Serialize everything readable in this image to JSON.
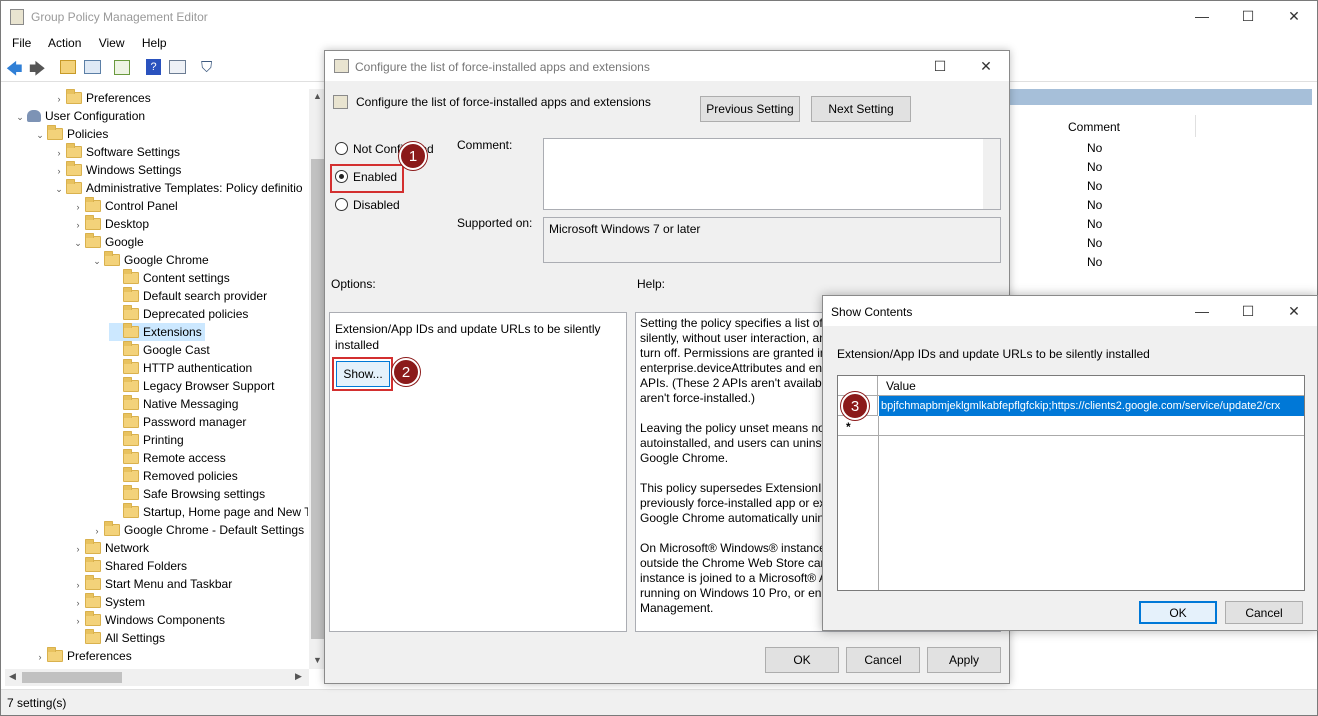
{
  "main_window": {
    "title": "Group Policy Management Editor",
    "menu": [
      "File",
      "Action",
      "View",
      "Help"
    ],
    "status": "7 setting(s)"
  },
  "tree": [
    {
      "label": "Preferences",
      "indent": 2,
      "chev": "›"
    },
    {
      "label": "User Configuration",
      "indent": 0,
      "chev": "⌄",
      "icon": "user"
    },
    {
      "label": "Policies",
      "indent": 1,
      "chev": "⌄"
    },
    {
      "label": "Software Settings",
      "indent": 2,
      "chev": "›"
    },
    {
      "label": "Windows Settings",
      "indent": 2,
      "chev": "›"
    },
    {
      "label": "Administrative Templates: Policy definitio",
      "indent": 2,
      "chev": "⌄"
    },
    {
      "label": "Control Panel",
      "indent": 3,
      "chev": "›"
    },
    {
      "label": "Desktop",
      "indent": 3,
      "chev": "›"
    },
    {
      "label": "Google",
      "indent": 3,
      "chev": "⌄"
    },
    {
      "label": "Google Chrome",
      "indent": 4,
      "chev": "⌄"
    },
    {
      "label": "Content settings",
      "indent": 5,
      "chev": ""
    },
    {
      "label": "Default search provider",
      "indent": 5,
      "chev": ""
    },
    {
      "label": "Deprecated policies",
      "indent": 5,
      "chev": ""
    },
    {
      "label": "Extensions",
      "indent": 5,
      "chev": "",
      "selected": true
    },
    {
      "label": "Google Cast",
      "indent": 5,
      "chev": ""
    },
    {
      "label": "HTTP authentication",
      "indent": 5,
      "chev": ""
    },
    {
      "label": "Legacy Browser Support",
      "indent": 5,
      "chev": ""
    },
    {
      "label": "Native Messaging",
      "indent": 5,
      "chev": ""
    },
    {
      "label": "Password manager",
      "indent": 5,
      "chev": ""
    },
    {
      "label": "Printing",
      "indent": 5,
      "chev": ""
    },
    {
      "label": "Remote access",
      "indent": 5,
      "chev": ""
    },
    {
      "label": "Removed policies",
      "indent": 5,
      "chev": ""
    },
    {
      "label": "Safe Browsing settings",
      "indent": 5,
      "chev": ""
    },
    {
      "label": "Startup, Home page and New T",
      "indent": 5,
      "chev": ""
    },
    {
      "label": "Google Chrome - Default Settings",
      "indent": 4,
      "chev": "›"
    },
    {
      "label": "Network",
      "indent": 3,
      "chev": "›"
    },
    {
      "label": "Shared Folders",
      "indent": 3,
      "chev": ""
    },
    {
      "label": "Start Menu and Taskbar",
      "indent": 3,
      "chev": "›"
    },
    {
      "label": "System",
      "indent": 3,
      "chev": "›"
    },
    {
      "label": "Windows Components",
      "indent": 3,
      "chev": "›"
    },
    {
      "label": "All Settings",
      "indent": 3,
      "chev": ""
    },
    {
      "label": "Preferences",
      "indent": 1,
      "chev": "›"
    }
  ],
  "right_list": {
    "column": "Comment",
    "rows": [
      "No",
      "No",
      "No",
      "No",
      "No",
      "No",
      "No"
    ]
  },
  "policy_dialog": {
    "title": "Configure the list of force-installed apps and extensions",
    "heading": "Configure the list of force-installed apps and extensions",
    "prev_btn": "Previous Setting",
    "next_btn": "Next Setting",
    "radio_not": "Not Configured",
    "radio_enabled": "Enabled",
    "radio_disabled": "Disabled",
    "comment_label": "Comment:",
    "supported_label": "Supported on:",
    "supported_value": "Microsoft Windows 7 or later",
    "options_label": "Options:",
    "help_label": "Help:",
    "option_text": "Extension/App IDs and update URLs to be silently installed",
    "show_btn": "Show...",
    "help_paragraphs": [
      "Setting the policy specifies a list of apps and extensions that install silently, without user interaction, and which users can't uninstall or turn off. Permissions are granted implicitly, including for the enterprise.deviceAttributes and enterprise.platformKeys extension APIs. (These 2 APIs aren't available to apps and extensions that aren't force-installed.)",
      "Leaving the policy unset means no apps or extensions are autoinstalled, and users can uninstall any app or extension in Google Chrome.",
      "This policy supersedes ExtensionInstallBlocklist policy. If a previously force-installed app or extension is removed from this list, Google Chrome automatically uninstalls it.",
      "On Microsoft® Windows® instances, apps and extensions from outside the Chrome Web Store can only be forced installed if the instance is joined to a Microsoft® Active Directory® domain, running on Windows 10 Pro, or enrolled in Chrome Browser Cloud Management."
    ],
    "ok": "OK",
    "cancel": "Cancel",
    "apply": "Apply"
  },
  "show_contents": {
    "title": "Show Contents",
    "desc": "Extension/App IDs and update URLs to be silently installed",
    "col": "Value",
    "value": "bpjfchmapbmjeklgmlkabfepflgfckip;https://clients2.google.com/service/update2/crx",
    "new_row_marker": "*",
    "ok": "OK",
    "cancel": "Cancel"
  },
  "badges": [
    "1",
    "2",
    "3"
  ]
}
